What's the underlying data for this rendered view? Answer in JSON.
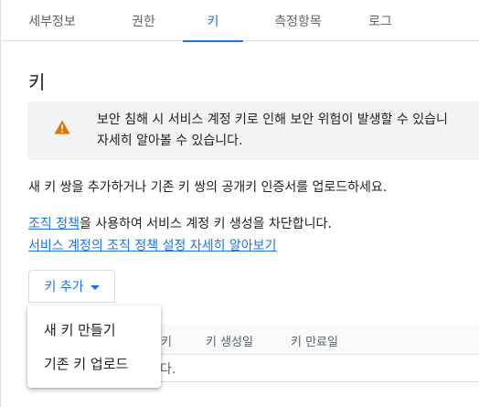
{
  "tabs": [
    {
      "label": "세부정보"
    },
    {
      "label": "권한"
    },
    {
      "label": "키"
    },
    {
      "label": "측정항목"
    },
    {
      "label": "로그"
    }
  ],
  "active_tab": "키",
  "section": {
    "title": "키"
  },
  "warning": {
    "line1": "보안 침해 시 서비스 계정 키로 인해 보안 위험이 발생할 수 있습니",
    "line2": "자세히 알아볼 수 있습니다.",
    "icon": "warning-triangle-icon",
    "icon_color": "#e37400"
  },
  "description": "새 키 쌍을 추가하거나 기존 키 쌍의 공개키 인증서를 업로드하세요.",
  "policy": {
    "link_text": "조직 정책",
    "rest_text": "을 사용하여 서비스 계정 키 생성을 차단합니다.",
    "learn_more": "서비스 계정의 조직 정책 설정 자세히 알아보기"
  },
  "add_key": {
    "label": "키 추가",
    "icon": "caret-down-icon"
  },
  "menu": {
    "items": [
      {
        "label": "새 키 만들기"
      },
      {
        "label": "기존 키 업로드"
      }
    ]
  },
  "table": {
    "columns": [
      "키",
      "키 생성일",
      "키 만료일"
    ],
    "empty_partial": "다."
  },
  "colors": {
    "accent": "#1a73e8",
    "banner_bg": "#f1f3f4",
    "warning": "#e37400"
  }
}
